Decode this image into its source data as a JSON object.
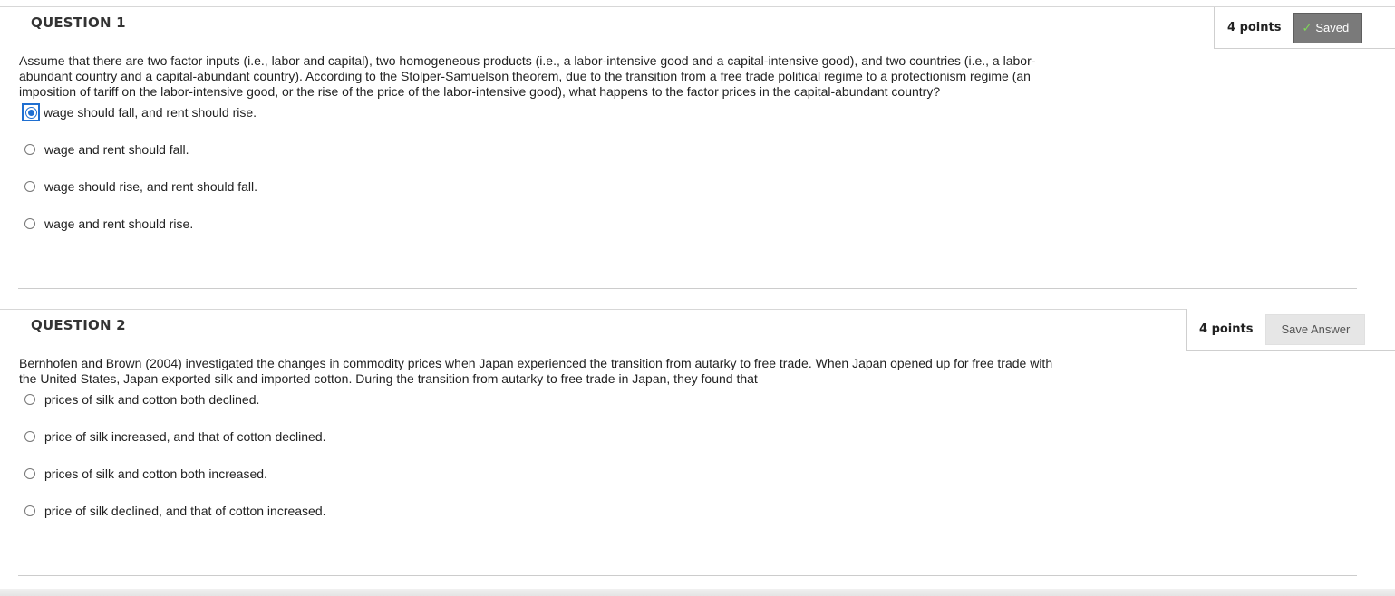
{
  "questions": [
    {
      "title": "QUESTION 1",
      "points": "4 points",
      "status_button": "Saved",
      "text": "Assume that there are two factor inputs (i.e., labor and capital), two homogeneous products (i.e., a labor-intensive good and a capital-intensive good), and two countries (i.e., a labor-abundant country and a capital-abundant country). According to the Stolper-Samuelson theorem, due to the transition from a free trade political regime to a protectionism regime (an imposition of tariff on the labor-intensive good, or the rise of the price of the labor-intensive good), what happens to the factor prices in the capital-abundant country?",
      "options": [
        "wage should fall, and rent should rise.",
        "wage and rent should fall.",
        "wage should rise, and rent should fall.",
        "wage and rent should rise."
      ],
      "selected_option": "wage should fall, and rent should rise."
    },
    {
      "title": "QUESTION 2",
      "points": "4 points",
      "status_button": "Save Answer",
      "text": "Bernhofen and Brown (2004) investigated the changes in commodity prices when Japan experienced the transition from autarky to free trade. When Japan opened up for free trade with the United States, Japan exported silk and imported cotton. During the transition from autarky to free trade in Japan, they found that",
      "options": [
        "prices of silk and cotton both declined.",
        "price of silk increased, and that of cotton declined.",
        "prices of silk and cotton both increased.",
        "price of silk declined, and that of cotton increased."
      ],
      "selected_option": ""
    }
  ],
  "icons": {
    "saved_check": "check-icon",
    "radio_selected": "radio-selected-icon",
    "radio_unselected": "radio-unselected-icon"
  },
  "colors": {
    "selected_radio": "#1f6fd1",
    "saved_button_bg": "#7a7a7a",
    "save_answer_button_bg": "#e6e6e6",
    "check_mark": "#7ed957"
  }
}
